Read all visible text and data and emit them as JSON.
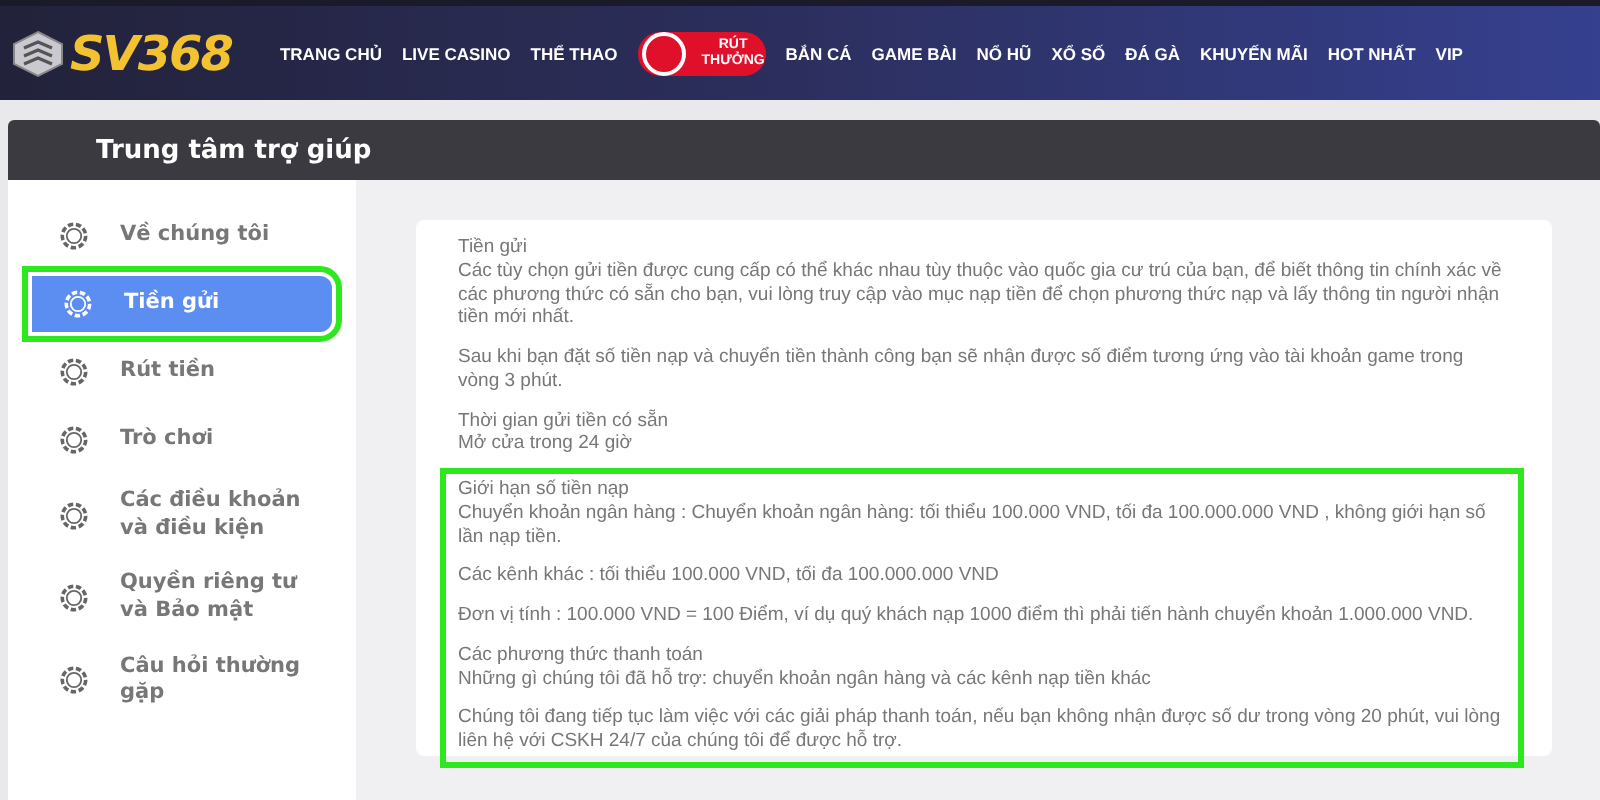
{
  "header": {
    "logo": "SV368",
    "nav": [
      {
        "kind": "link",
        "label": "TRANG CHỦ"
      },
      {
        "kind": "link",
        "label": "LIVE CASINO"
      },
      {
        "kind": "link",
        "label": "THỂ THAO"
      },
      {
        "kind": "promo",
        "label": "RÚT THƯỞNG"
      },
      {
        "kind": "link",
        "label": "BẮN CÁ"
      },
      {
        "kind": "link",
        "label": "GAME BÀI"
      },
      {
        "kind": "link",
        "label": "NỔ HŨ"
      },
      {
        "kind": "link",
        "label": "XỔ SỐ"
      },
      {
        "kind": "link",
        "label": "ĐÁ GÀ"
      },
      {
        "kind": "link",
        "label": "KHUYẾN MÃI"
      },
      {
        "kind": "link",
        "label": "HOT NHẤT"
      },
      {
        "kind": "link",
        "label": "VIP"
      }
    ]
  },
  "help": {
    "title": "Trung tâm trợ giúp",
    "sidebar": {
      "items": [
        {
          "label": "Về chúng tôi",
          "selected": false,
          "highlighted": false
        },
        {
          "label": "Tiền gửi",
          "selected": true,
          "highlighted": true
        },
        {
          "label": "Rút tiền",
          "selected": false,
          "highlighted": false
        },
        {
          "label": "Trò chơi",
          "selected": false,
          "highlighted": false
        },
        {
          "label": "Các điều khoản và điều kiện",
          "selected": false,
          "highlighted": false
        },
        {
          "label": "Quyền riêng tư và Bảo mật",
          "selected": false,
          "highlighted": false
        },
        {
          "label": "Câu hỏi thường gặp",
          "selected": false,
          "highlighted": false
        }
      ]
    },
    "content": {
      "blocks": [
        {
          "highlighted": false,
          "paragraphs": [
            [
              "Tiền gửi",
              "Các tùy chọn gửi tiền được cung cấp có thể khác nhau tùy thuộc vào quốc gia cư trú của bạn, để biết thông tin chính xác về các phương thức có sẵn cho bạn, vui lòng truy cập vào mục nạp tiền để chọn phương thức nạp và lấy thông tin người nhận tiền mới nhất."
            ],
            [
              "Sau khi bạn đặt số tiền nạp và chuyển tiền thành công bạn sẽ nhận được số điểm tương ứng vào tài khoản game trong vòng 3 phút."
            ],
            [
              "Thời gian gửi tiền có sẵn",
              "Mở cửa trong 24 giờ"
            ]
          ]
        },
        {
          "highlighted": true,
          "paragraphs": [
            [
              "Giới hạn số tiền nạp",
              "Chuyển khoản ngân hàng :  Chuyển khoản ngân hàng: tối thiểu 100.000 VND, tối đa 100.000.000 VND , không giới hạn số lần nạp tiền."
            ],
            [
              "Các kênh khác :  tối thiểu 100.000 VND, tối đa 100.000.000 VND"
            ],
            [
              "Đơn vị tính : 100.000 VND = 100 Điểm, ví dụ quý khách nạp 1000 điểm thì phải tiến hành chuyển khoản 1.000.000 VND."
            ],
            [
              "Các phương thức thanh toán",
              "Những gì chúng tôi đã hỗ trợ: chuyển khoản ngân hàng và các kênh nạp tiền khác"
            ],
            [
              "Chúng tôi đang tiếp tục làm việc với các giải pháp thanh toán, nếu bạn không nhận được số dư trong vòng 20 phút, vui lòng liên hệ với CSKH 24/7 của chúng tôi để được hỗ trợ."
            ]
          ]
        }
      ]
    }
  }
}
